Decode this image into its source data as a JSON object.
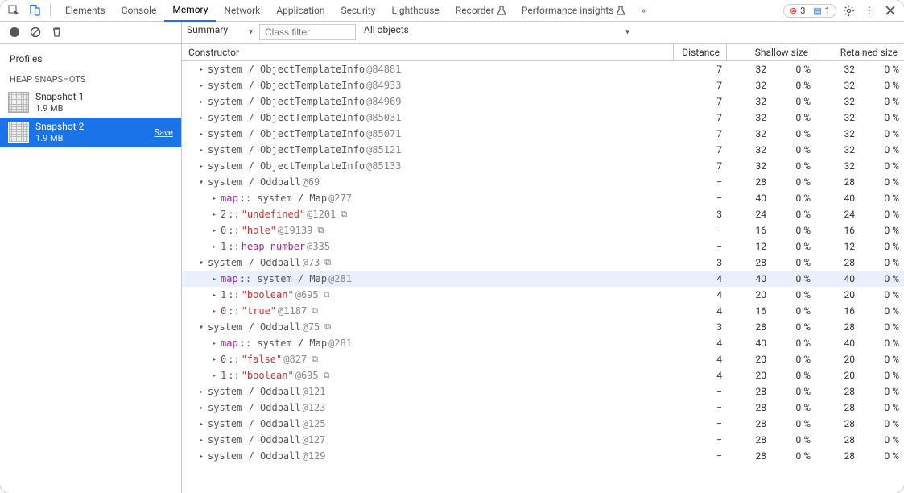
{
  "topbar": {
    "tabs": [
      "Elements",
      "Console",
      "Memory",
      "Network",
      "Application",
      "Security",
      "Lighthouse",
      "Recorder",
      "Performance insights"
    ],
    "active_index": 2,
    "beta_indices": [
      7,
      8
    ],
    "errors": 3,
    "infos": 1
  },
  "toolbar": {
    "view": "Summary",
    "filter_placeholder": "Class filter",
    "filter_value": "",
    "object_scope": "All objects"
  },
  "sidebar": {
    "title": "Profiles",
    "heading": "HEAP SNAPSHOTS",
    "snapshots": [
      {
        "name": "Snapshot 1",
        "size": "1.9 MB",
        "selected": false,
        "has_save": false
      },
      {
        "name": "Snapshot 2",
        "size": "1.9 MB",
        "selected": true,
        "has_save": true
      }
    ],
    "save_label": "Save"
  },
  "heap_headers": {
    "constructor": "Constructor",
    "distance": "Distance",
    "shallow": "Shallow size",
    "retained": "Retained size"
  },
  "rows": [
    {
      "depth": 0,
      "tw": "r",
      "segs": [
        {
          "t": "gray",
          "v": "system / ObjectTemplateInfo "
        },
        {
          "t": "at",
          "v": "@84881"
        }
      ],
      "dist": "7",
      "ss": "32",
      "ssp": "0 %",
      "rs": "32",
      "rsp": "0 %",
      "copy": false,
      "hover": false
    },
    {
      "depth": 0,
      "tw": "r",
      "segs": [
        {
          "t": "gray",
          "v": "system / ObjectTemplateInfo "
        },
        {
          "t": "at",
          "v": "@84933"
        }
      ],
      "dist": "7",
      "ss": "32",
      "ssp": "0 %",
      "rs": "32",
      "rsp": "0 %",
      "copy": false,
      "hover": false
    },
    {
      "depth": 0,
      "tw": "r",
      "segs": [
        {
          "t": "gray",
          "v": "system / ObjectTemplateInfo "
        },
        {
          "t": "at",
          "v": "@84969"
        }
      ],
      "dist": "7",
      "ss": "32",
      "ssp": "0 %",
      "rs": "32",
      "rsp": "0 %",
      "copy": false,
      "hover": false
    },
    {
      "depth": 0,
      "tw": "r",
      "segs": [
        {
          "t": "gray",
          "v": "system / ObjectTemplateInfo "
        },
        {
          "t": "at",
          "v": "@85031"
        }
      ],
      "dist": "7",
      "ss": "32",
      "ssp": "0 %",
      "rs": "32",
      "rsp": "0 %",
      "copy": false,
      "hover": false
    },
    {
      "depth": 0,
      "tw": "r",
      "segs": [
        {
          "t": "gray",
          "v": "system / ObjectTemplateInfo "
        },
        {
          "t": "at",
          "v": "@85071"
        }
      ],
      "dist": "7",
      "ss": "32",
      "ssp": "0 %",
      "rs": "32",
      "rsp": "0 %",
      "copy": false,
      "hover": false
    },
    {
      "depth": 0,
      "tw": "r",
      "segs": [
        {
          "t": "gray",
          "v": "system / ObjectTemplateInfo "
        },
        {
          "t": "at",
          "v": "@85121"
        }
      ],
      "dist": "7",
      "ss": "32",
      "ssp": "0 %",
      "rs": "32",
      "rsp": "0 %",
      "copy": false,
      "hover": false
    },
    {
      "depth": 0,
      "tw": "r",
      "segs": [
        {
          "t": "gray",
          "v": "system / ObjectTemplateInfo "
        },
        {
          "t": "at",
          "v": "@85133"
        }
      ],
      "dist": "7",
      "ss": "32",
      "ssp": "0 %",
      "rs": "32",
      "rsp": "0 %",
      "copy": false,
      "hover": false
    },
    {
      "depth": 0,
      "tw": "d",
      "segs": [
        {
          "t": "gray",
          "v": "system / Oddball "
        },
        {
          "t": "at",
          "v": "@69"
        }
      ],
      "dist": "−",
      "ss": "28",
      "ssp": "0 %",
      "rs": "28",
      "rsp": "0 %",
      "copy": false,
      "hover": false
    },
    {
      "depth": 1,
      "tw": "r",
      "segs": [
        {
          "t": "purple",
          "v": "map"
        },
        {
          "t": "gray",
          "v": " :: system / Map "
        },
        {
          "t": "at",
          "v": "@277"
        }
      ],
      "dist": "−",
      "ss": "40",
      "ssp": "0 %",
      "rs": "40",
      "rsp": "0 %",
      "copy": false,
      "hover": false
    },
    {
      "depth": 1,
      "tw": "r",
      "segs": [
        {
          "t": "purple",
          "v": "2"
        },
        {
          "t": "gray",
          "v": " :: "
        },
        {
          "t": "red",
          "v": "\"undefined\""
        },
        {
          "t": "at",
          "v": " @1201"
        }
      ],
      "dist": "3",
      "ss": "24",
      "ssp": "0 %",
      "rs": "24",
      "rsp": "0 %",
      "copy": true,
      "hover": false
    },
    {
      "depth": 1,
      "tw": "r",
      "segs": [
        {
          "t": "purple",
          "v": "0"
        },
        {
          "t": "gray",
          "v": " :: "
        },
        {
          "t": "red",
          "v": "\"hole\""
        },
        {
          "t": "at",
          "v": " @19139"
        }
      ],
      "dist": "−",
      "ss": "16",
      "ssp": "0 %",
      "rs": "16",
      "rsp": "0 %",
      "copy": true,
      "hover": false
    },
    {
      "depth": 1,
      "tw": "r",
      "segs": [
        {
          "t": "purple",
          "v": "1"
        },
        {
          "t": "gray",
          "v": " :: "
        },
        {
          "t": "purple",
          "v": "heap number"
        },
        {
          "t": "at",
          "v": " @335"
        }
      ],
      "dist": "−",
      "ss": "12",
      "ssp": "0 %",
      "rs": "12",
      "rsp": "0 %",
      "copy": false,
      "hover": false
    },
    {
      "depth": 0,
      "tw": "d",
      "segs": [
        {
          "t": "gray",
          "v": "system / Oddball "
        },
        {
          "t": "at",
          "v": "@73"
        }
      ],
      "dist": "3",
      "ss": "28",
      "ssp": "0 %",
      "rs": "28",
      "rsp": "0 %",
      "copy": true,
      "hover": false
    },
    {
      "depth": 1,
      "tw": "r",
      "segs": [
        {
          "t": "purple",
          "v": "map"
        },
        {
          "t": "gray",
          "v": " :: system / Map "
        },
        {
          "t": "at",
          "v": "@281"
        }
      ],
      "dist": "4",
      "ss": "40",
      "ssp": "0 %",
      "rs": "40",
      "rsp": "0 %",
      "copy": false,
      "hover": true
    },
    {
      "depth": 1,
      "tw": "r",
      "segs": [
        {
          "t": "purple",
          "v": "1"
        },
        {
          "t": "gray",
          "v": " :: "
        },
        {
          "t": "red",
          "v": "\"boolean\""
        },
        {
          "t": "at",
          "v": " @695"
        }
      ],
      "dist": "4",
      "ss": "20",
      "ssp": "0 %",
      "rs": "20",
      "rsp": "0 %",
      "copy": true,
      "hover": false
    },
    {
      "depth": 1,
      "tw": "r",
      "segs": [
        {
          "t": "purple",
          "v": "0"
        },
        {
          "t": "gray",
          "v": " :: "
        },
        {
          "t": "red",
          "v": "\"true\""
        },
        {
          "t": "at",
          "v": " @1187"
        }
      ],
      "dist": "4",
      "ss": "16",
      "ssp": "0 %",
      "rs": "16",
      "rsp": "0 %",
      "copy": true,
      "hover": false
    },
    {
      "depth": 0,
      "tw": "d",
      "segs": [
        {
          "t": "gray",
          "v": "system / Oddball "
        },
        {
          "t": "at",
          "v": "@75"
        }
      ],
      "dist": "3",
      "ss": "28",
      "ssp": "0 %",
      "rs": "28",
      "rsp": "0 %",
      "copy": true,
      "hover": false
    },
    {
      "depth": 1,
      "tw": "r",
      "segs": [
        {
          "t": "purple",
          "v": "map"
        },
        {
          "t": "gray",
          "v": " :: system / Map "
        },
        {
          "t": "at",
          "v": "@281"
        }
      ],
      "dist": "4",
      "ss": "40",
      "ssp": "0 %",
      "rs": "40",
      "rsp": "0 %",
      "copy": false,
      "hover": false
    },
    {
      "depth": 1,
      "tw": "r",
      "segs": [
        {
          "t": "purple",
          "v": "0"
        },
        {
          "t": "gray",
          "v": " :: "
        },
        {
          "t": "red",
          "v": "\"false\""
        },
        {
          "t": "at",
          "v": " @827"
        }
      ],
      "dist": "4",
      "ss": "20",
      "ssp": "0 %",
      "rs": "20",
      "rsp": "0 %",
      "copy": true,
      "hover": false
    },
    {
      "depth": 1,
      "tw": "r",
      "segs": [
        {
          "t": "purple",
          "v": "1"
        },
        {
          "t": "gray",
          "v": " :: "
        },
        {
          "t": "red",
          "v": "\"boolean\""
        },
        {
          "t": "at",
          "v": " @695"
        }
      ],
      "dist": "4",
      "ss": "20",
      "ssp": "0 %",
      "rs": "20",
      "rsp": "0 %",
      "copy": true,
      "hover": false
    },
    {
      "depth": 0,
      "tw": "r",
      "segs": [
        {
          "t": "gray",
          "v": "system / Oddball "
        },
        {
          "t": "at",
          "v": "@121"
        }
      ],
      "dist": "−",
      "ss": "28",
      "ssp": "0 %",
      "rs": "28",
      "rsp": "0 %",
      "copy": false,
      "hover": false
    },
    {
      "depth": 0,
      "tw": "r",
      "segs": [
        {
          "t": "gray",
          "v": "system / Oddball "
        },
        {
          "t": "at",
          "v": "@123"
        }
      ],
      "dist": "−",
      "ss": "28",
      "ssp": "0 %",
      "rs": "28",
      "rsp": "0 %",
      "copy": false,
      "hover": false
    },
    {
      "depth": 0,
      "tw": "r",
      "segs": [
        {
          "t": "gray",
          "v": "system / Oddball "
        },
        {
          "t": "at",
          "v": "@125"
        }
      ],
      "dist": "−",
      "ss": "28",
      "ssp": "0 %",
      "rs": "28",
      "rsp": "0 %",
      "copy": false,
      "hover": false
    },
    {
      "depth": 0,
      "tw": "r",
      "segs": [
        {
          "t": "gray",
          "v": "system / Oddball "
        },
        {
          "t": "at",
          "v": "@127"
        }
      ],
      "dist": "−",
      "ss": "28",
      "ssp": "0 %",
      "rs": "28",
      "rsp": "0 %",
      "copy": false,
      "hover": false
    },
    {
      "depth": 0,
      "tw": "r",
      "segs": [
        {
          "t": "gray",
          "v": "system / Oddball "
        },
        {
          "t": "at",
          "v": "@129"
        }
      ],
      "dist": "−",
      "ss": "28",
      "ssp": "0 %",
      "rs": "28",
      "rsp": "0 %",
      "copy": false,
      "hover": false
    }
  ]
}
